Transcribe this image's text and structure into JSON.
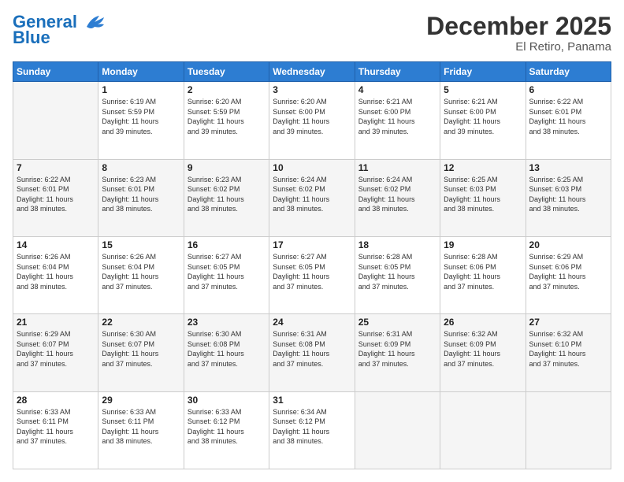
{
  "header": {
    "logo_line1": "General",
    "logo_line2": "Blue",
    "month": "December 2025",
    "location": "El Retiro, Panama"
  },
  "weekdays": [
    "Sunday",
    "Monday",
    "Tuesday",
    "Wednesday",
    "Thursday",
    "Friday",
    "Saturday"
  ],
  "weeks": [
    [
      {
        "day": "",
        "info": ""
      },
      {
        "day": "1",
        "info": "Sunrise: 6:19 AM\nSunset: 5:59 PM\nDaylight: 11 hours\nand 39 minutes."
      },
      {
        "day": "2",
        "info": "Sunrise: 6:20 AM\nSunset: 5:59 PM\nDaylight: 11 hours\nand 39 minutes."
      },
      {
        "day": "3",
        "info": "Sunrise: 6:20 AM\nSunset: 6:00 PM\nDaylight: 11 hours\nand 39 minutes."
      },
      {
        "day": "4",
        "info": "Sunrise: 6:21 AM\nSunset: 6:00 PM\nDaylight: 11 hours\nand 39 minutes."
      },
      {
        "day": "5",
        "info": "Sunrise: 6:21 AM\nSunset: 6:00 PM\nDaylight: 11 hours\nand 39 minutes."
      },
      {
        "day": "6",
        "info": "Sunrise: 6:22 AM\nSunset: 6:01 PM\nDaylight: 11 hours\nand 38 minutes."
      }
    ],
    [
      {
        "day": "7",
        "info": "Sunrise: 6:22 AM\nSunset: 6:01 PM\nDaylight: 11 hours\nand 38 minutes."
      },
      {
        "day": "8",
        "info": "Sunrise: 6:23 AM\nSunset: 6:01 PM\nDaylight: 11 hours\nand 38 minutes."
      },
      {
        "day": "9",
        "info": "Sunrise: 6:23 AM\nSunset: 6:02 PM\nDaylight: 11 hours\nand 38 minutes."
      },
      {
        "day": "10",
        "info": "Sunrise: 6:24 AM\nSunset: 6:02 PM\nDaylight: 11 hours\nand 38 minutes."
      },
      {
        "day": "11",
        "info": "Sunrise: 6:24 AM\nSunset: 6:02 PM\nDaylight: 11 hours\nand 38 minutes."
      },
      {
        "day": "12",
        "info": "Sunrise: 6:25 AM\nSunset: 6:03 PM\nDaylight: 11 hours\nand 38 minutes."
      },
      {
        "day": "13",
        "info": "Sunrise: 6:25 AM\nSunset: 6:03 PM\nDaylight: 11 hours\nand 38 minutes."
      }
    ],
    [
      {
        "day": "14",
        "info": "Sunrise: 6:26 AM\nSunset: 6:04 PM\nDaylight: 11 hours\nand 38 minutes."
      },
      {
        "day": "15",
        "info": "Sunrise: 6:26 AM\nSunset: 6:04 PM\nDaylight: 11 hours\nand 37 minutes."
      },
      {
        "day": "16",
        "info": "Sunrise: 6:27 AM\nSunset: 6:05 PM\nDaylight: 11 hours\nand 37 minutes."
      },
      {
        "day": "17",
        "info": "Sunrise: 6:27 AM\nSunset: 6:05 PM\nDaylight: 11 hours\nand 37 minutes."
      },
      {
        "day": "18",
        "info": "Sunrise: 6:28 AM\nSunset: 6:05 PM\nDaylight: 11 hours\nand 37 minutes."
      },
      {
        "day": "19",
        "info": "Sunrise: 6:28 AM\nSunset: 6:06 PM\nDaylight: 11 hours\nand 37 minutes."
      },
      {
        "day": "20",
        "info": "Sunrise: 6:29 AM\nSunset: 6:06 PM\nDaylight: 11 hours\nand 37 minutes."
      }
    ],
    [
      {
        "day": "21",
        "info": "Sunrise: 6:29 AM\nSunset: 6:07 PM\nDaylight: 11 hours\nand 37 minutes."
      },
      {
        "day": "22",
        "info": "Sunrise: 6:30 AM\nSunset: 6:07 PM\nDaylight: 11 hours\nand 37 minutes."
      },
      {
        "day": "23",
        "info": "Sunrise: 6:30 AM\nSunset: 6:08 PM\nDaylight: 11 hours\nand 37 minutes."
      },
      {
        "day": "24",
        "info": "Sunrise: 6:31 AM\nSunset: 6:08 PM\nDaylight: 11 hours\nand 37 minutes."
      },
      {
        "day": "25",
        "info": "Sunrise: 6:31 AM\nSunset: 6:09 PM\nDaylight: 11 hours\nand 37 minutes."
      },
      {
        "day": "26",
        "info": "Sunrise: 6:32 AM\nSunset: 6:09 PM\nDaylight: 11 hours\nand 37 minutes."
      },
      {
        "day": "27",
        "info": "Sunrise: 6:32 AM\nSunset: 6:10 PM\nDaylight: 11 hours\nand 37 minutes."
      }
    ],
    [
      {
        "day": "28",
        "info": "Sunrise: 6:33 AM\nSunset: 6:11 PM\nDaylight: 11 hours\nand 37 minutes."
      },
      {
        "day": "29",
        "info": "Sunrise: 6:33 AM\nSunset: 6:11 PM\nDaylight: 11 hours\nand 38 minutes."
      },
      {
        "day": "30",
        "info": "Sunrise: 6:33 AM\nSunset: 6:12 PM\nDaylight: 11 hours\nand 38 minutes."
      },
      {
        "day": "31",
        "info": "Sunrise: 6:34 AM\nSunset: 6:12 PM\nDaylight: 11 hours\nand 38 minutes."
      },
      {
        "day": "",
        "info": ""
      },
      {
        "day": "",
        "info": ""
      },
      {
        "day": "",
        "info": ""
      }
    ]
  ]
}
